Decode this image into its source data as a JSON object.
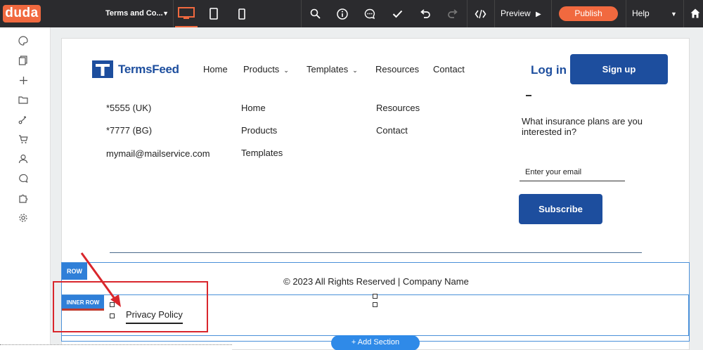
{
  "topbar": {
    "logo": "duda",
    "page_name": "Terms and Co...",
    "preview": "Preview",
    "publish": "Publish",
    "help": "Help"
  },
  "site": {
    "brand": "TermsFeed",
    "nav": [
      {
        "label": "Home"
      },
      {
        "label": "Products"
      },
      {
        "label": "Templates"
      },
      {
        "label": "Resources"
      },
      {
        "label": "Contact"
      }
    ],
    "login": "Log in",
    "signup": "Sign up"
  },
  "footer": {
    "contacts": [
      "*5555 (UK)",
      "*7777 (BG)",
      "mymail@mailservice.com"
    ],
    "links_col1": [
      "Home",
      "Products",
      "Templates"
    ],
    "links_col2": [
      "Resources",
      "Contact"
    ],
    "question": "What insurance plans are you interested in?",
    "email_placeholder": "Enter your email",
    "subscribe": "Subscribe",
    "copyright": "© 2023 All Rights Reserved | Company Name",
    "privacy": "Privacy Policy"
  },
  "editor": {
    "row_badge": "ROW",
    "inner_row_badge": "INNER ROW",
    "add_section": "+ Add Section"
  },
  "colors": {
    "accent": "#f1693f",
    "brand_blue": "#1d4e9e",
    "selection_blue": "#2f7fd8",
    "annotation_red": "#d9262c"
  }
}
